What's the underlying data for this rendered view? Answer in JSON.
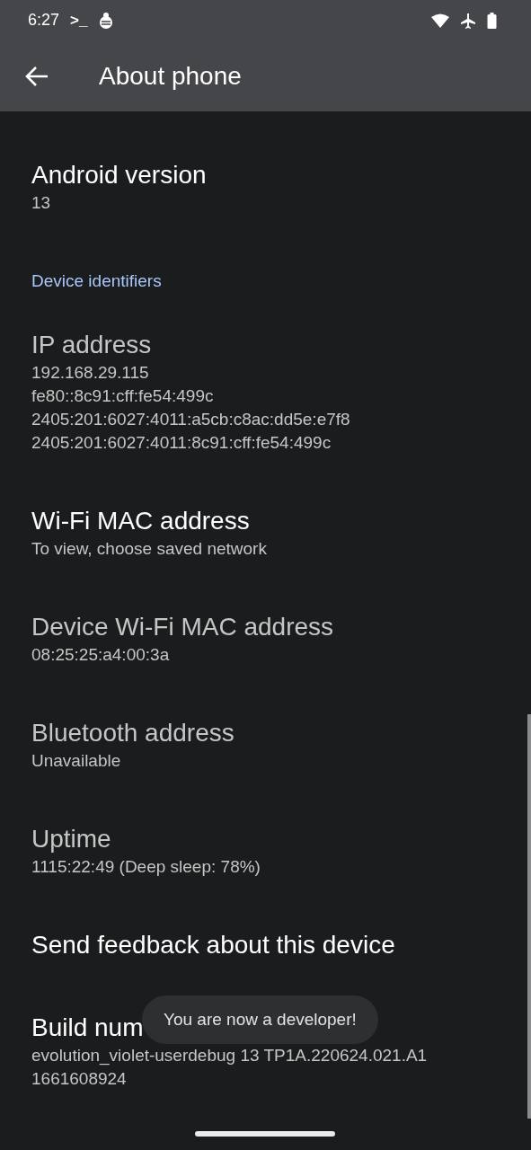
{
  "status_bar": {
    "time": "6:27",
    "terminal_glyph": ">_"
  },
  "app_bar": {
    "title": "About phone"
  },
  "sections": [
    {
      "items": [
        {
          "title": "Android version",
          "lines": [
            "13"
          ],
          "disabled": false
        }
      ]
    },
    {
      "header": "Device identifiers",
      "items": [
        {
          "title": "IP address",
          "lines": [
            "192.168.29.115",
            "fe80::8c91:cff:fe54:499c",
            "2405:201:6027:4011:a5cb:c8ac:dd5e:e7f8",
            "2405:201:6027:4011:8c91:cff:fe54:499c"
          ],
          "disabled": true
        },
        {
          "title": "Wi-Fi MAC address",
          "lines": [
            "To view, choose saved network"
          ],
          "disabled": false
        },
        {
          "title": "Device Wi-Fi MAC address",
          "lines": [
            "08:25:25:a4:00:3a"
          ],
          "disabled": true
        },
        {
          "title": "Bluetooth address",
          "lines": [
            "Unavailable"
          ],
          "disabled": true
        },
        {
          "title": "Uptime",
          "lines": [
            "1115:22:49 (Deep sleep: 78%)"
          ],
          "disabled": true
        },
        {
          "title": "Send feedback about this device",
          "disabled": false
        },
        {
          "title": "Build num",
          "lines": [
            "evolution_violet-userdebug 13 TP1A.220624.021.A1",
            "1661608924"
          ],
          "disabled": false
        }
      ]
    }
  ],
  "toast": "You are now a developer!"
}
